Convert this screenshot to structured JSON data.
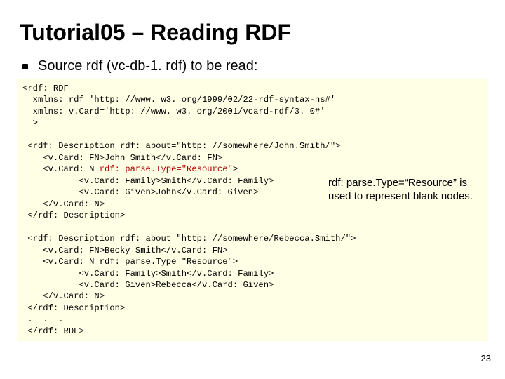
{
  "title": "Tutorial05 – Reading RDF",
  "bullet": "Source rdf (vc-db-1. rdf) to be read:",
  "code": {
    "open_rdf": "<rdf: RDF",
    "ns_rdf": "  xmlns: rdf='http: //www. w3. org/1999/02/22-rdf-syntax-ns#'",
    "ns_vcard": "  xmlns: v.Card='http: //www. w3. org/2001/vcard-rdf/3. 0#'",
    "close_open": "  >",
    "blank1": "",
    "d1_open": " <rdf: Description rdf: about=\"http: //somewhere/John.Smith/\">",
    "d1_fn": "    <v.Card: FN>John Smith</v.Card: FN>",
    "d1_n_open_a": "    <v.Card: N ",
    "d1_n_open_hl": "rdf: parse.Type=\"Resource\"",
    "d1_n_open_b": ">",
    "d1_family": "           <v.Card: Family>Smith</v.Card: Family>",
    "d1_given": "           <v.Card: Given>John</v.Card: Given>",
    "d1_n_close": "    </v.Card: N>",
    "d1_close": " </rdf: Description>",
    "blank2": "",
    "d2_open": " <rdf: Description rdf: about=\"http: //somewhere/Rebecca.Smith/\">",
    "d2_fn": "    <v.Card: FN>Becky Smith</v.Card: FN>",
    "d2_n_open": "    <v.Card: N rdf: parse.Type=\"Resource\">",
    "d2_family": "           <v.Card: Family>Smith</v.Card: Family>",
    "d2_given": "           <v.Card: Given>Rebecca</v.Card: Given>",
    "d2_n_close": "    </v.Card: N>",
    "d2_close": " </rdf: Description>",
    "dots": " .  .  .",
    "close_rdf": " </rdf: RDF>"
  },
  "note": "rdf: parse.Type=“Resource” is used to represent blank nodes.",
  "page_num": "23"
}
